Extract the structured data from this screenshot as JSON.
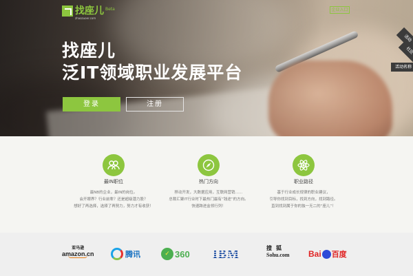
{
  "header": {
    "logo_text": "找座儿",
    "logo_beta": "Beta",
    "logo_sub": "zhaozuoer.com",
    "enterprise_link": "企业入口"
  },
  "hero": {
    "title_line1": "找座儿",
    "title_line2": "泛IT领域职业发展平台",
    "login_label": "登录",
    "register_label": "注册"
  },
  "side_tabs": [
    "活动",
    "社区",
    "活动名称"
  ],
  "features": [
    {
      "icon": "people-icon",
      "title": "最IN职位",
      "desc": [
        "最NB的企业，最IN的岗位。",
        "会开眼界？行业前辈？还是超级潜力股？",
        "想好了再选择，选择了再努力，努力才有收获！"
      ]
    },
    {
      "icon": "compass-icon",
      "title": "热门方向",
      "desc": [
        "移动开发，大数据应用，互联网营销……",
        "总裁汇聚IT行业时下最热门最有“钱途”的方向。",
        "快速跨进金领行列！"
      ]
    },
    {
      "icon": "atom-icon",
      "title": "职业路径",
      "desc": [
        "基于行业成长规律的职业建议，",
        "引导你找到目标，找到方向，找到路径。",
        "直到找到属于你的独一无二的“座儿”！"
      ]
    }
  ],
  "partners": {
    "amazon_cn": "亚马逊",
    "amazon_en": "amazon.cn",
    "qq": "腾讯",
    "p360": "360",
    "p360_mark": "✓",
    "ibm": "IBM",
    "sohu_cn": "搜狐",
    "sohu_en": "Sohu.com",
    "baidu_left": "Bai",
    "baidu_right": "百度"
  },
  "colors": {
    "accent": "#8dc63f",
    "partner_bg": "#efefef",
    "feature_bg": "#f5f5f2"
  }
}
